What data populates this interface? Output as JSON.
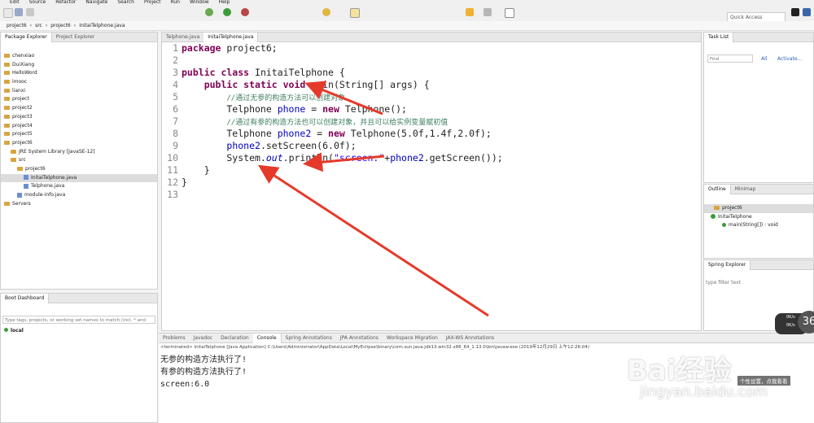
{
  "menu": [
    "Edit",
    "Source",
    "Refactor",
    "Navigate",
    "Search",
    "Project",
    "Run",
    "Window",
    "Help"
  ],
  "toolbar": {
    "quick_access": "Quick Access"
  },
  "breadcrumb": [
    "project6",
    "src",
    "project6",
    "InitaiTelphone.java"
  ],
  "package_explorer": {
    "tabs": [
      "Package Explorer",
      "Project Explorer"
    ],
    "items": [
      {
        "label": "chenxiao",
        "indent": 0,
        "kind": "folder"
      },
      {
        "label": "DuiXiang",
        "indent": 0,
        "kind": "folder"
      },
      {
        "label": "HelloWord",
        "indent": 0,
        "kind": "folder"
      },
      {
        "label": "imooc",
        "indent": 0,
        "kind": "folder"
      },
      {
        "label": "lianxi",
        "indent": 0,
        "kind": "folder"
      },
      {
        "label": "project",
        "indent": 0,
        "kind": "folder"
      },
      {
        "label": "project2",
        "indent": 0,
        "kind": "folder"
      },
      {
        "label": "project3",
        "indent": 0,
        "kind": "folder"
      },
      {
        "label": "project4",
        "indent": 0,
        "kind": "folder"
      },
      {
        "label": "project5",
        "indent": 0,
        "kind": "folder"
      },
      {
        "label": "project6",
        "indent": 0,
        "kind": "folder"
      },
      {
        "label": "JRE System Library [JavaSE-12]",
        "indent": 1,
        "kind": "folder"
      },
      {
        "label": "src",
        "indent": 1,
        "kind": "folder"
      },
      {
        "label": "project6",
        "indent": 2,
        "kind": "folder"
      },
      {
        "label": "InitaiTelphone.java",
        "indent": 3,
        "kind": "java",
        "selected": true
      },
      {
        "label": "Telphone.java",
        "indent": 3,
        "kind": "java"
      },
      {
        "label": "module-info.java",
        "indent": 2,
        "kind": "java"
      },
      {
        "label": "Servers",
        "indent": 0,
        "kind": "folder"
      }
    ]
  },
  "boot_dashboard": {
    "title": "Boot Dashboard",
    "filter_placeholder": "Type tags, projects, or working set names to match (incl. * and",
    "item": "local"
  },
  "editor": {
    "tabs": [
      "Telphone.java",
      "InitaiTelphone.java"
    ],
    "lines": [
      {
        "n": "1",
        "html": "<span class=\"kw\">package</span> project6;"
      },
      {
        "n": "2",
        "html": ""
      },
      {
        "n": "3",
        "html": "<span class=\"kw\">public class</span> InitaiTelphone {"
      },
      {
        "n": "4",
        "html": "    <span class=\"kw\">public static void</span> main(String[] args) {"
      },
      {
        "n": "5",
        "html": "        <span class=\"cm\">//通过无参的构造方法可以创建对象</span>"
      },
      {
        "n": "6",
        "html": "        Telphone <span class=\"fd\">phone</span> = <span class=\"kw\">new</span> Telphone();"
      },
      {
        "n": "7",
        "html": "        <span class=\"cm\">//通过有参的构造方法也可以创建对象，并且可以给实例变量赋初值</span>"
      },
      {
        "n": "8",
        "html": "        Telphone <span class=\"fd\">phone2</span> = <span class=\"kw\">new</span> Telphone(5.0f,1.4f,2.0f);"
      },
      {
        "n": "9",
        "html": "        <span class=\"fd\">phone2</span>.setScreen(6.0f);"
      },
      {
        "n": "10",
        "html": "        System.<span class=\"fi\">out</span>.println(<span class=\"st\">\"screen:\"</span>+<span class=\"fd\">phone2</span>.getScreen());"
      },
      {
        "n": "11",
        "html": "    }"
      },
      {
        "n": "12",
        "html": "}"
      },
      {
        "n": "13",
        "html": ""
      }
    ]
  },
  "task_list": {
    "title": "Task List",
    "find_placeholder": "Find",
    "all": "All",
    "activate": "Activate..."
  },
  "outline": {
    "tabs": [
      "Outline",
      "Minimap"
    ],
    "items": [
      "project6",
      "InitaiTelphone",
      "main(String[]) : void"
    ]
  },
  "spring_explorer": {
    "title": "Spring Explorer",
    "filter_placeholder": "type filter text"
  },
  "console": {
    "tabs": [
      "Problems",
      "Javadoc",
      "Declaration",
      "Console",
      "Spring Annotations",
      "JPA Annotations",
      "Workspace Migration",
      "JAX-WS Annotations"
    ],
    "terminated": "<terminated> InitaiTelphone [Java Application] C:\\Users\\Administrator\\AppData\\Local\\MyEclipse\\binary\\com.sun.java.jdk13.win32.x86_64_1.13.0\\bin\\javaw.exe (2019年12月29日 上午12:26:04)",
    "output": [
      "无参的构造方法执行了!",
      "有参的构造方法执行了!",
      "screen:6.0"
    ]
  },
  "overlay": {
    "net_up": "0K/s",
    "net_down": "0K/s",
    "badge": "36",
    "tooltip": "个性设置，点我看看",
    "watermark_main": "Bai经验",
    "watermark_sub": "jingyan.baidu.com"
  },
  "colors": {
    "keyword": "#7f0055",
    "comment": "#3f7f5f",
    "string": "#2a00ff",
    "field": "#0000c0",
    "arrow": "#e53a2a"
  }
}
